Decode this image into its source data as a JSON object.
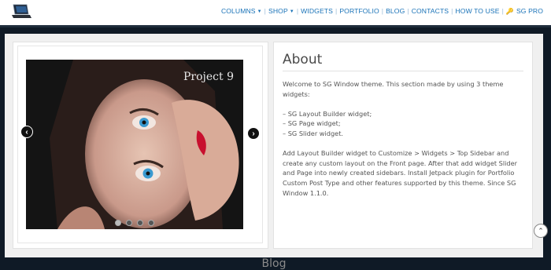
{
  "header": {
    "logo_icon": "laptop-icon",
    "nav": [
      {
        "label": "COLUMNS",
        "dropdown": true
      },
      {
        "label": "SHOP",
        "dropdown": true
      },
      {
        "label": "WIDGETS",
        "dropdown": false
      },
      {
        "label": "PORTFOLIO",
        "dropdown": false
      },
      {
        "label": "BLOG",
        "dropdown": false
      },
      {
        "label": "CONTACTS",
        "dropdown": false
      },
      {
        "label": "HOW TO USE",
        "dropdown": false
      },
      {
        "label": "SG PRO",
        "dropdown": false,
        "icon": "key-icon"
      }
    ]
  },
  "slider": {
    "title": "Project 9",
    "prev_icon": "chevron-left-icon",
    "next_icon": "chevron-right-icon",
    "slide_count": 4,
    "active_slide": 1
  },
  "about": {
    "title": "About",
    "paragraphs": [
      "Welcome to SG Window theme. This section made by using 3 theme widgets:",
      "– SG Layout Builder widget;\n– SG Page widget;\n– SG Slider widget.",
      "Add Layout Builder widget to Customize > Widgets > Top Sidebar and create any custom layout on the Front page. After that add widget Slider and Page into newly created sidebars. Install Jetpack plugin for Portfolio Custom Post Type and other features supported by this theme. Since SG Window 1.1.0."
    ]
  },
  "blog": {
    "heading": "Blog"
  },
  "scroll_top_icon": "chevron-up-icon",
  "colors": {
    "nav_link": "#1a73b8",
    "dark_bg": "#0f1a26"
  }
}
